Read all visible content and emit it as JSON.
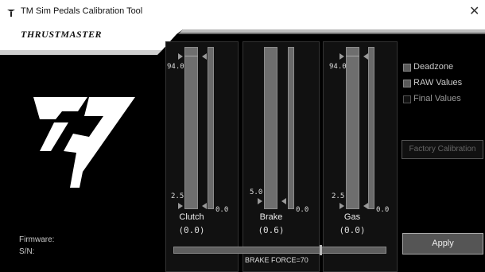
{
  "window": {
    "title": "TM Sim Pedals Calibration Tool",
    "close_glyph": "✕"
  },
  "brand": {
    "name": "THRUSTMASTER",
    "logo_icon": "tm-logo-icon"
  },
  "pedals": [
    {
      "name": "Clutch",
      "value_display": "(0.0)",
      "top_label": "94.0",
      "bottom_label": "2.5",
      "side_value": "0.0"
    },
    {
      "name": "Brake",
      "value_display": "(0.6)",
      "top_label": "",
      "bottom_label": "5.0",
      "side_value": "0.0"
    },
    {
      "name": "Gas",
      "value_display": "(0.0)",
      "top_label": "94.0",
      "bottom_label": "2.5",
      "side_value": "0.0"
    }
  ],
  "brake_force": {
    "label": "BRAKE FORCE=70"
  },
  "options": [
    {
      "label": "Deadzone",
      "checked": false
    },
    {
      "label": "RAW Values",
      "checked": false
    },
    {
      "label": "Final Values",
      "checked": false
    }
  ],
  "buttons": {
    "factory_calibration": "Factory Calibration",
    "apply": "Apply"
  },
  "info": {
    "firmware_label": "Firmware:",
    "sn_label": "S/N:"
  },
  "colors": {
    "background": "#000000",
    "bar_fill": "#6e6e6e",
    "bar_border": "#8c8c8c",
    "accent_red": "#c00000"
  }
}
